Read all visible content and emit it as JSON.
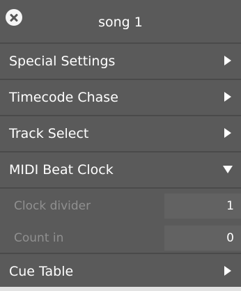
{
  "window": {
    "title": "song 1",
    "close_icon": "close-icon"
  },
  "menu": {
    "special_settings": {
      "label": "Special Settings",
      "expanded": false
    },
    "timecode_chase": {
      "label": "Timecode Chase",
      "expanded": false
    },
    "track_select": {
      "label": "Track Select",
      "expanded": false
    },
    "midi_beat_clock": {
      "label": "MIDI Beat Clock",
      "expanded": true,
      "params": {
        "clock_divider": {
          "label": "Clock divider",
          "value": "1"
        },
        "count_in": {
          "label": "Count in",
          "value": "0"
        }
      }
    },
    "cue_table": {
      "label": "Cue Table",
      "expanded": false
    }
  },
  "colors": {
    "panel_bg": "#5a5a5a",
    "separator": "#4a4a4a",
    "text": "#ffffff",
    "dim_text": "#909090",
    "field_bg": "#626262"
  }
}
